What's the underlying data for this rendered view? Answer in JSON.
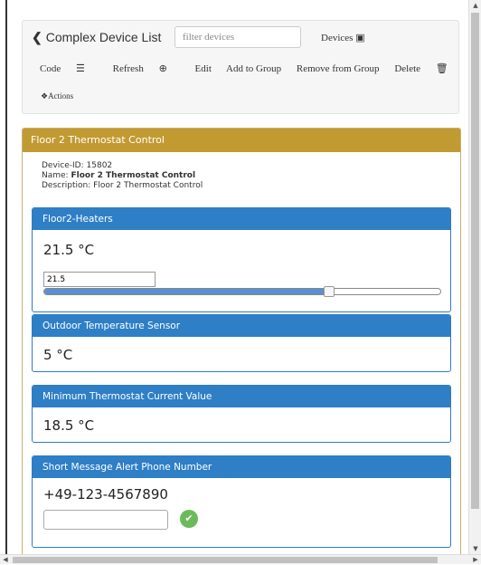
{
  "toolbar": {
    "back_label": "Complex Device List",
    "filter_placeholder": "filter devices",
    "devices_label": "Devices",
    "code_label": "Code",
    "refresh_label": "Refresh",
    "edit_label": "Edit",
    "add_group_label": "Add to Group",
    "remove_group_label": "Remove from Group",
    "delete_label": "Delete",
    "actions_label": "Actions"
  },
  "device": {
    "header": "Floor 2 Thermostat Control",
    "id_label": "Device-ID:",
    "id_value": "15802",
    "name_label": "Name:",
    "name_value": "Floor 2 Thermostat Control",
    "description_label": "Description:",
    "description_value": "Floor 2 Thermostat Control"
  },
  "panels": {
    "heaters": {
      "title": "Floor2-Heaters",
      "value": "21.5 °C",
      "input_value": "21.5",
      "slider_fraction": 0.72
    },
    "outdoor": {
      "title": "Outdoor Temperature Sensor",
      "value": "5 °C"
    },
    "minimum": {
      "title": "Minimum Thermostat Current Value",
      "value": "18.5 °C"
    },
    "sms": {
      "title": "Short Message Alert Phone Number",
      "value": "+49-123-4567890",
      "input_value": ""
    }
  },
  "colors": {
    "card_header": "#c29a32",
    "panel_header": "#2f7fc6",
    "slider_fill": "#5b8fd0",
    "confirm": "#6cbb5a"
  }
}
